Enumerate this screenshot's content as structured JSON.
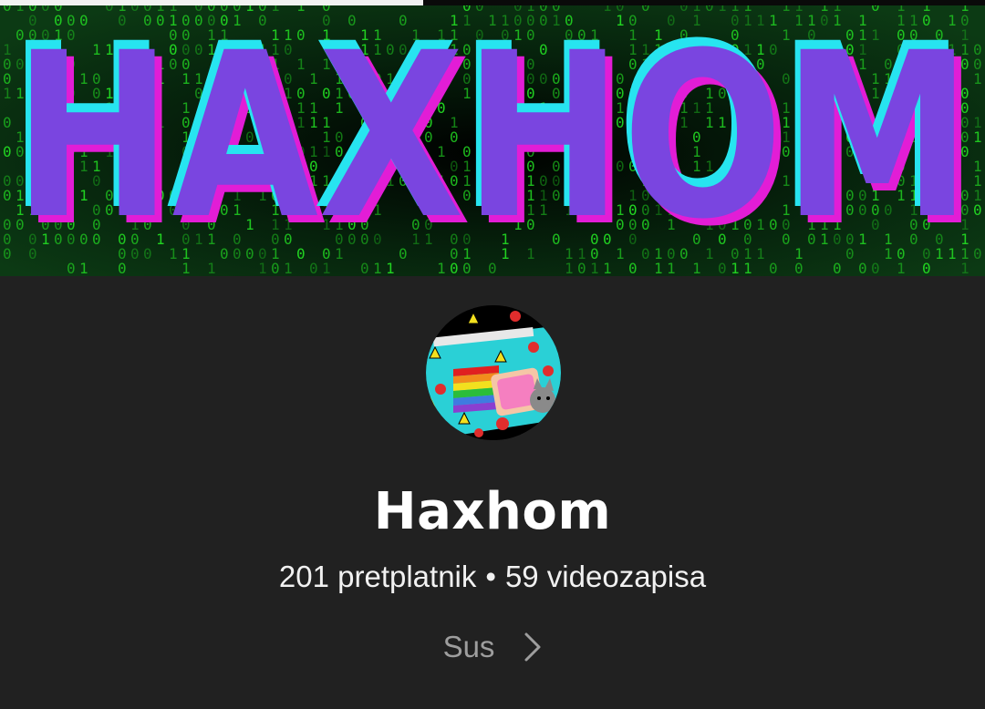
{
  "banner": {
    "title": "HAXHOM"
  },
  "progress": {
    "fraction": 0.43
  },
  "channel": {
    "name": "Haxhom",
    "subscribers": "201 pretplatnik",
    "separator": "•",
    "videos": "59 videozapisa"
  },
  "more": {
    "label": "Sus",
    "icon": "chevron-right-icon"
  },
  "colors": {
    "background": "#212121",
    "banner_text": "#7a45e0",
    "banner_outline_cyan": "#27e4f0",
    "banner_outline_magenta": "#e21dd6",
    "matrix_green": "#1fd61f"
  }
}
